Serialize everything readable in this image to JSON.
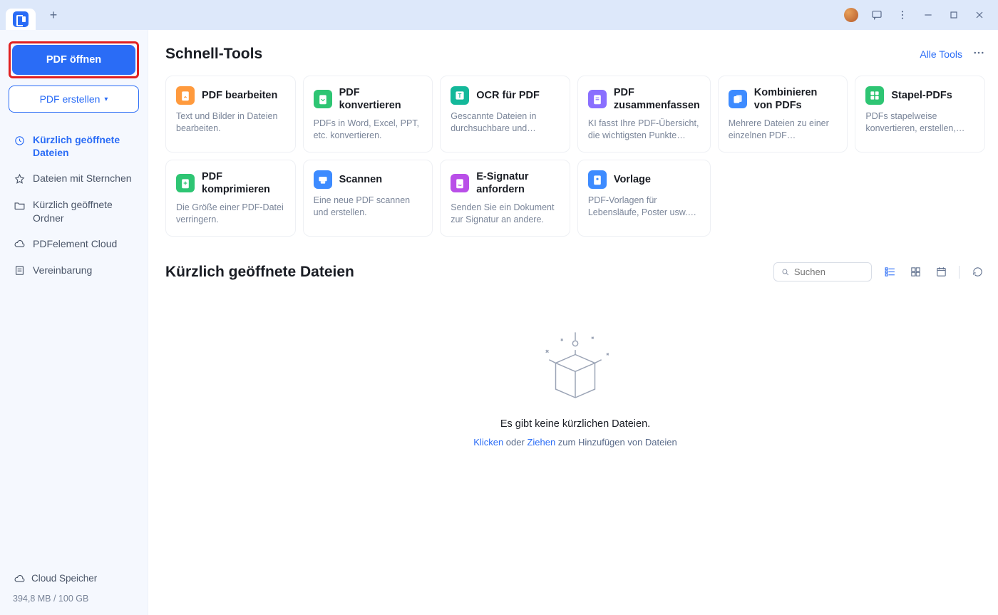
{
  "titlebar": {
    "plus": "+"
  },
  "sidebar": {
    "open_label": "PDF öffnen",
    "create_label": "PDF erstellen",
    "nav": [
      {
        "label": "Kürzlich geöffnete Dateien"
      },
      {
        "label": "Dateien mit Sternchen"
      },
      {
        "label": "Kürzlich geöffnete Ordner"
      },
      {
        "label": "PDFelement Cloud"
      },
      {
        "label": "Vereinbarung"
      }
    ],
    "cloud_label": "Cloud Speicher",
    "cloud_size": "394,8 MB / 100 GB"
  },
  "quicktools": {
    "title": "Schnell-Tools",
    "all_label": "Alle Tools",
    "cards": [
      {
        "title": "PDF bearbeiten",
        "desc": "Text und Bilder in Dateien bearbeiten.",
        "color": "#ff9a3d"
      },
      {
        "title": "PDF konvertieren",
        "desc": "PDFs in Word, Excel, PPT, etc. konvertieren.",
        "color": "#2ec573"
      },
      {
        "title": "OCR für PDF",
        "desc": "Gescannte Dateien in durchsuchbare und bearbeit...",
        "color": "#14b89a"
      },
      {
        "title": "PDF zusammenfassen",
        "desc": "KI fasst Ihre PDF-Übersicht, die wichtigsten Punkte usw...",
        "color": "#8a6fff"
      },
      {
        "title": "Kombinieren von PDFs",
        "desc": "Mehrere Dateien zu einer einzelnen PDF zusammenfü...",
        "color": "#3d8bff"
      },
      {
        "title": "Stapel-PDFs",
        "desc": "PDFs stapelweise konvertieren, erstellen, druc...",
        "color": "#2ec573"
      },
      {
        "title": "PDF komprimieren",
        "desc": "Die Größe einer PDF-Datei verringern.",
        "color": "#2ec573"
      },
      {
        "title": "Scannen",
        "desc": "Eine neue PDF scannen und erstellen.",
        "color": "#3d8bff"
      },
      {
        "title": "E-Signatur anfordern",
        "desc": "Senden Sie ein Dokument zur Signatur an andere.",
        "color": "#b94fe8"
      },
      {
        "title": "Vorlage",
        "desc": "PDF-Vorlagen für Lebensläufe, Poster usw. erh...",
        "color": "#3d8bff"
      }
    ]
  },
  "recent": {
    "title": "Kürzlich geöffnete Dateien",
    "search_placeholder": "Suchen",
    "empty_text": "Es gibt keine kürzlichen Dateien.",
    "hint_click": "Klicken",
    "hint_or": " oder ",
    "hint_drag": "Ziehen",
    "hint_rest": " zum Hinzufügen von Dateien"
  }
}
